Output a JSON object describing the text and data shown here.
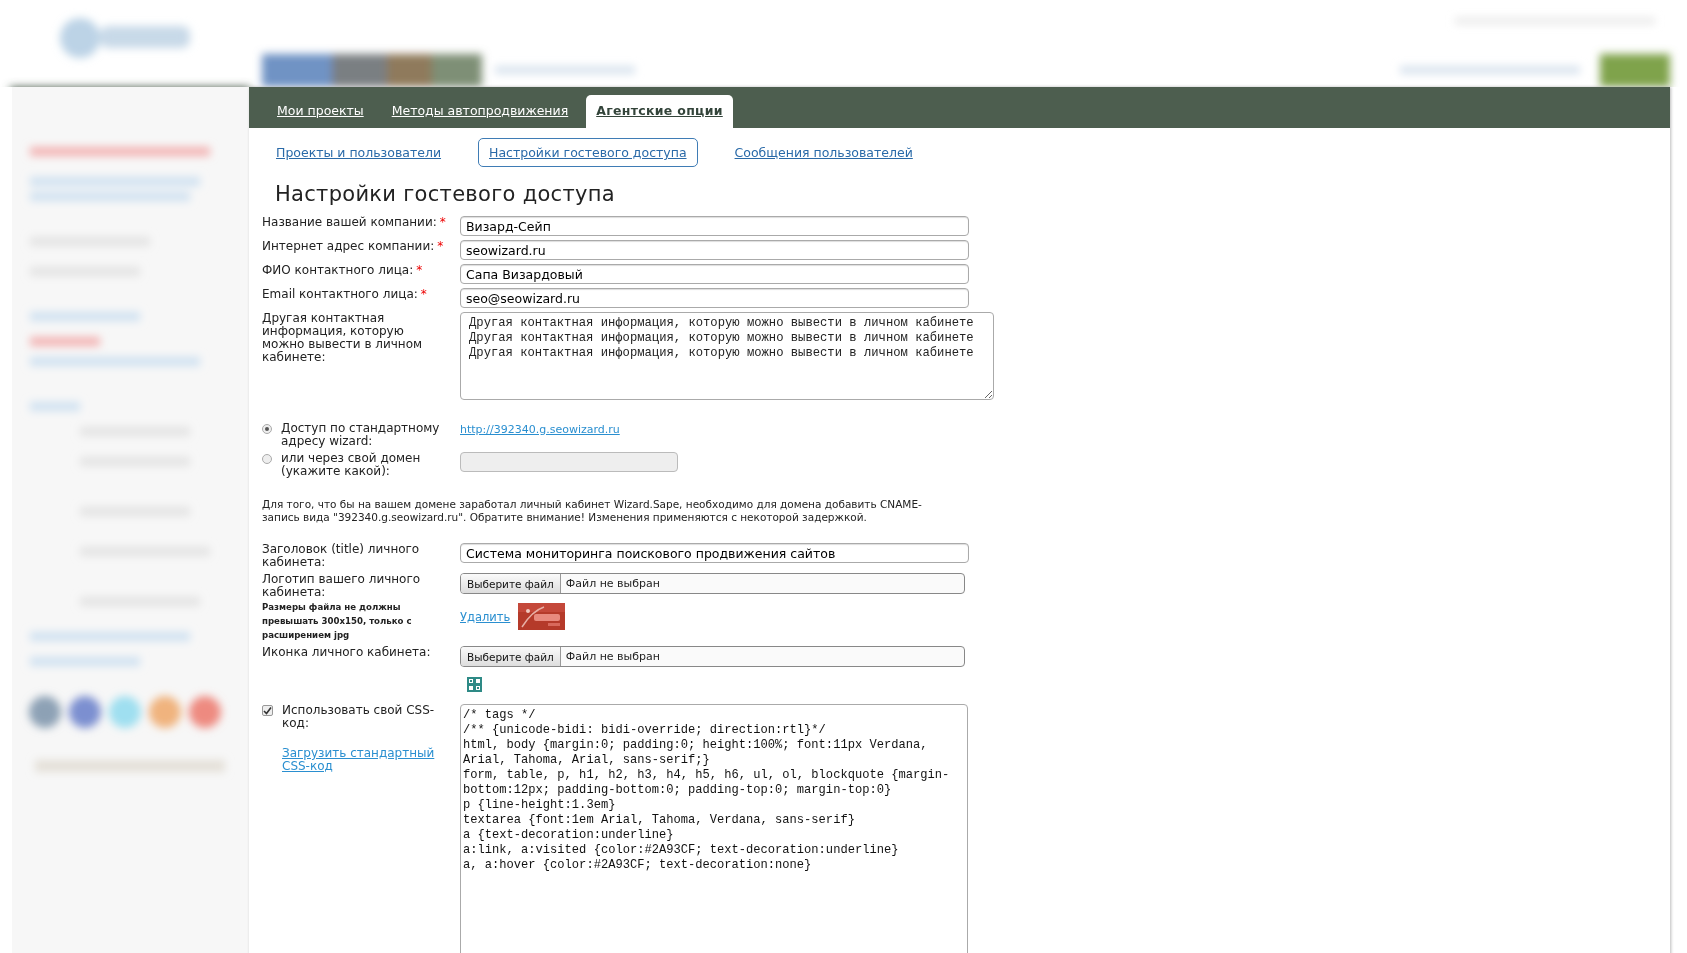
{
  "main_tabs": [
    {
      "label": "Мои проекты",
      "selected": false
    },
    {
      "label": "Методы автопродвижения",
      "selected": false
    },
    {
      "label": "Агентские опции",
      "selected": true
    }
  ],
  "sub_tabs": [
    {
      "label": "Проекты и пользователи",
      "selected": false
    },
    {
      "label": "Настройки гостевого доступа",
      "selected": true
    },
    {
      "label": "Сообщения пользователей",
      "selected": false
    }
  ],
  "heading": "Настройки гостевого доступа",
  "fields": [
    {
      "kind": "text",
      "label": "Название вашей компании:",
      "mark": "*",
      "value": "Визард-Сейп"
    },
    {
      "kind": "text",
      "label": "Интернет адрес компании:",
      "mark": "*",
      "value": "seowizard.ru"
    },
    {
      "kind": "text",
      "label": "ФИО контактного лица:",
      "mark": "*",
      "value": "Сапа Визардовый"
    },
    {
      "kind": "text",
      "label": "Email контактного лица:",
      "mark": "*",
      "value": "seo@seowizard.ru"
    },
    {
      "kind": "textarea",
      "label": "Другая контактная информация, которую можно вывести в личном кабинете:",
      "value": "Другая контактная информация, которую можно вывести в личном кабинете Другая контактная информация, которую можно вывести в личном кабинете\nДругая контактная информация, которую можно вывести в личном кабинете"
    }
  ],
  "access": [
    {
      "kind": "link",
      "label": "Доступ по стандартному адресу wizard:",
      "selected": true,
      "link": "http://392340.g.seowizard.ru"
    },
    {
      "kind": "input",
      "label": "или через свой домен (укажите какой):",
      "selected": false
    }
  ],
  "note": "Для того, что бы на вашем домене заработал личный кабинет Wizard.Sape, необходимо для домена добавить CNAME-запись вида \"392340.g.seowizard.ru\". Обратите внимание! Изменения применяются с некоторой задержкой.",
  "title_field": {
    "label": "Заголовок (title) личного кабинета:",
    "value": "Система мониторинга поискового продвижения сайтов"
  },
  "logo_field": {
    "label": "Логотип вашего личного кабинета:",
    "hint": "Размеры файла не должны превышать 300x150, только с расширением jpg",
    "button": "Выберите файл",
    "status": "Файл не выбран",
    "delete_link": "Удалить"
  },
  "icon_field": {
    "label": "Иконка личного кабинета:",
    "button": "Выберите файл",
    "status": "Файл не выбран"
  },
  "css": {
    "checked": true,
    "label": "Использовать свой CSS-код:",
    "link": "Загрузить стандартный CSS-код",
    "code": "/* tags */\n/** {unicode-bidi: bidi-override; direction:rtl}*/\nhtml, body {margin:0; padding:0; height:100%; font:11px Verdana, Arial, Tahoma, Arial, sans-serif;}\nform, table, p, h1, h2, h3, h4, h5, h6, ul, ol, blockquote {margin-bottom:12px; padding-bottom:0; padding-top:0; margin-top:0}\np {line-height:1.3em}\ntextarea {font:1em Arial, Tahoma, Verdana, sans-serif}\na {text-decoration:underline}\na:link, a:visited {color:#2A93CF; text-decoration:underline}\na, a:hover {color:#2A93CF; text-decoration:none}"
  }
}
